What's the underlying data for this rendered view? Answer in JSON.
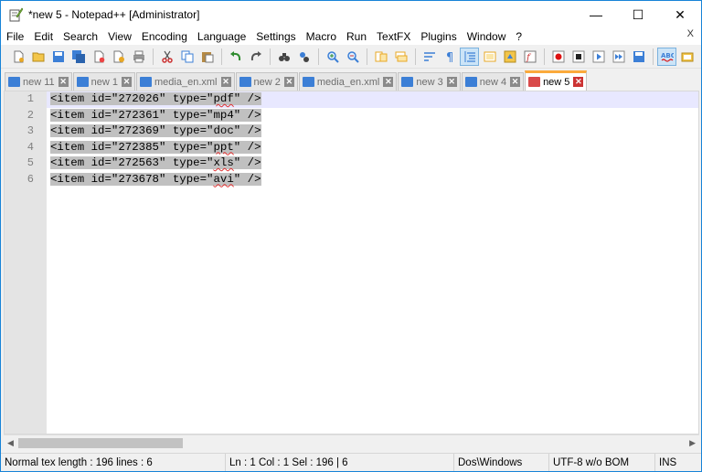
{
  "window": {
    "title": "*new 5 - Notepad++ [Administrator]",
    "controls": {
      "minimize": "—",
      "maximize": "☐",
      "close": "✕"
    }
  },
  "menu": {
    "items": [
      "File",
      "Edit",
      "Search",
      "View",
      "Encoding",
      "Language",
      "Settings",
      "Macro",
      "Run",
      "TextFX",
      "Plugins",
      "Window",
      "?"
    ],
    "close_doc": "X"
  },
  "toolbar": {
    "buttons": [
      "new-file",
      "open-file",
      "save",
      "save-all",
      "close",
      "close-all",
      "print",
      "cut",
      "copy",
      "paste",
      "undo",
      "redo",
      "find",
      "replace",
      "zoom-in",
      "zoom-out",
      "sync-vertical",
      "sync-horizontal",
      "word-wrap",
      "show-all-chars",
      "indent-guide",
      "user-lang",
      "doc-map",
      "function-list",
      "record-macro",
      "stop-record",
      "play-macro",
      "run-macro-multiple",
      "save-macro",
      "spell-check",
      "clipboard-history"
    ],
    "active": "indent-guide"
  },
  "tabs": [
    {
      "label": "new 11",
      "saved": true
    },
    {
      "label": "new 1",
      "saved": true
    },
    {
      "label": "media_en.xml",
      "saved": true
    },
    {
      "label": "new 2",
      "saved": true
    },
    {
      "label": "media_en.xml",
      "saved": true
    },
    {
      "label": "new 3",
      "saved": true
    },
    {
      "label": "new 4",
      "saved": true
    },
    {
      "label": "new 5",
      "saved": false,
      "active": true
    }
  ],
  "editor": {
    "lines": [
      {
        "num": "1",
        "prefix": "<item id=\"272026\" type=\"",
        "ext": "pdf",
        "suffix": "\" />"
      },
      {
        "num": "2",
        "prefix": "<item id=\"272361\" type=\"",
        "ext": "mp4",
        "suffix": "\" />"
      },
      {
        "num": "3",
        "prefix": "<item id=\"272369\" type=\"",
        "ext": "doc",
        "suffix": "\" />"
      },
      {
        "num": "4",
        "prefix": "<item id=\"272385\" type=\"",
        "ext": "ppt",
        "suffix": "\" />"
      },
      {
        "num": "5",
        "prefix": "<item id=\"272563\" type=\"",
        "ext": "xls",
        "suffix": "\" />"
      },
      {
        "num": "6",
        "prefix": "<item id=\"273678\" type=\"",
        "ext": "avi",
        "suffix": "\" />"
      }
    ]
  },
  "status": {
    "type_length": "Normal tex length : 196    lines : 6",
    "position": "Ln : 1    Col : 1    Sel : 196 | 6",
    "eol": "Dos\\Windows",
    "encoding": "UTF-8 w/o BOM",
    "mode": "INS"
  },
  "colors": {
    "accent": "#1883d7",
    "tab_active_top": "#fbaa3c",
    "selection": "#c0c0c0",
    "current_line": "#e8e8ff",
    "tab_saved_icon": "#3c7fd6",
    "tab_unsaved_icon": "#d94a4a"
  }
}
